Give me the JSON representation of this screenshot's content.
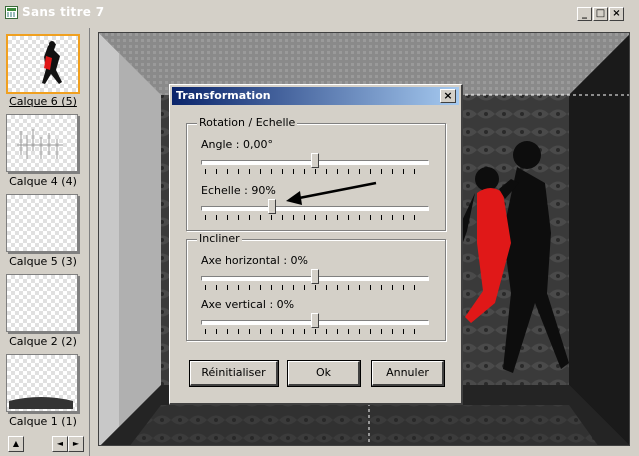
{
  "window": {
    "title": "Sans titre 7",
    "minimize_glyph": "_",
    "maximize_glyph": "□",
    "close_glyph": "×"
  },
  "layers": [
    {
      "label": "Calque 6 (5)",
      "selected": true
    },
    {
      "label": "Calque 4 (4)",
      "selected": false
    },
    {
      "label": "Calque 5 (3)",
      "selected": false
    },
    {
      "label": "Calque 2 (2)",
      "selected": false
    },
    {
      "label": "Calque 1 (1)",
      "selected": false
    }
  ],
  "layers_scroll": {
    "up_glyph": "▲",
    "left_glyph": "◄",
    "right_glyph": "►"
  },
  "dialog": {
    "title": "Transformation",
    "close_glyph": "×",
    "rotation_group": {
      "label": "Rotation / Echelle",
      "angle_label": "Angle : 0,00°",
      "angle_position": 0.5,
      "scale_label": "Echelle : 90%",
      "scale_position": 0.31
    },
    "skew_group": {
      "label": "Incliner",
      "horizontal_label": "Axe horizontal : 0%",
      "horizontal_position": 0.5,
      "vertical_label": "Axe vertical : 0%",
      "vertical_position": 0.5
    },
    "buttons": {
      "reset": "Réinitialiser",
      "ok": "Ok",
      "cancel": "Annuler"
    }
  },
  "colors": {
    "title_active": "#0a246a",
    "title_gradient_end": "#a6caf0",
    "selected_layer_border": "#f0a020",
    "dress_red": "#e01818",
    "chrome": "#d4d0c8"
  }
}
